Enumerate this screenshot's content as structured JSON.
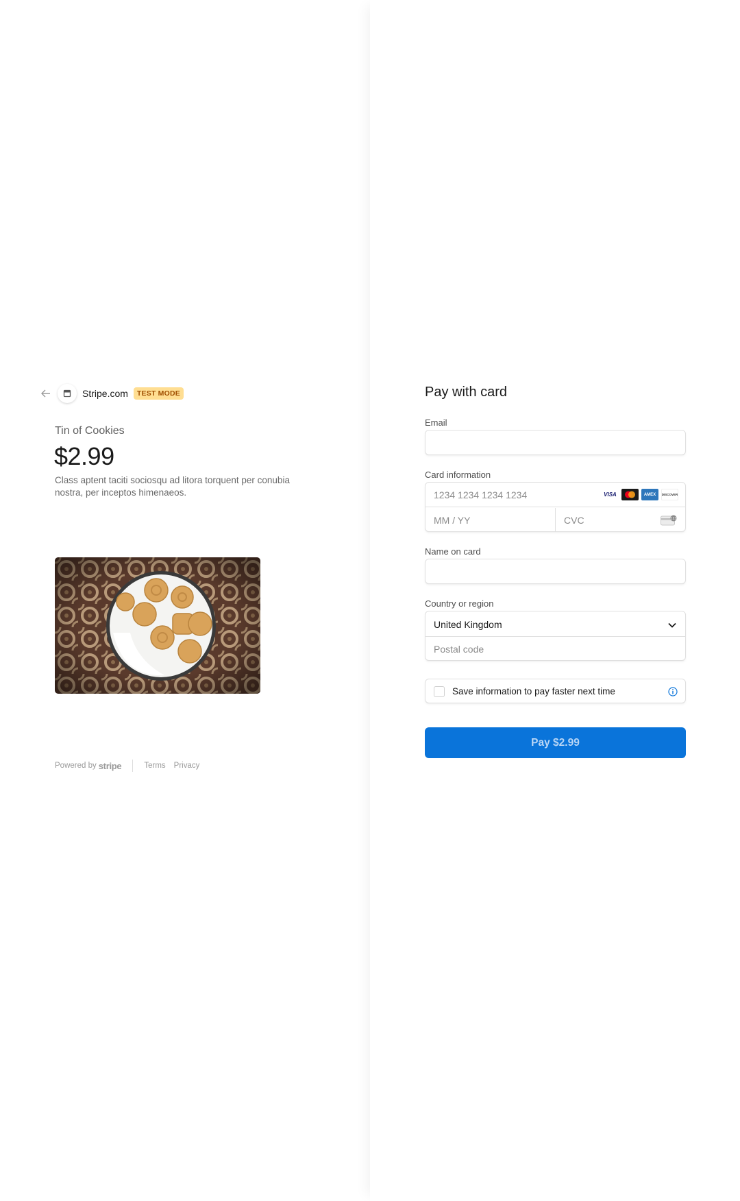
{
  "header": {
    "merchant_name": "Stripe.com",
    "badge": "TEST MODE"
  },
  "product": {
    "name": "Tin of Cookies",
    "price": "$2.99",
    "description": "Class aptent taciti sociosqu ad litora torquent per conubia nostra, per inceptos himenaeos."
  },
  "footer": {
    "powered_by": "Powered by",
    "brand": "stripe",
    "terms": "Terms",
    "privacy": "Privacy"
  },
  "form": {
    "title": "Pay with card",
    "email_label": "Email",
    "email_value": "",
    "card_label": "Card information",
    "card_number_placeholder": "1234 1234 1234 1234",
    "expiry_placeholder": "MM / YY",
    "cvc_placeholder": "CVC",
    "name_label": "Name on card",
    "name_value": "",
    "country_label": "Country or region",
    "country_value": "United Kingdom",
    "postal_placeholder": "Postal code",
    "save_info_label": "Save information to pay faster next time",
    "pay_button": "Pay $2.99",
    "card_brands": [
      "VISA",
      "mastercard",
      "AMEX",
      "DISCOVER"
    ]
  },
  "colors": {
    "accent": "#0a74da",
    "badge_bg": "#ffde92",
    "badge_text": "#a04e00"
  }
}
